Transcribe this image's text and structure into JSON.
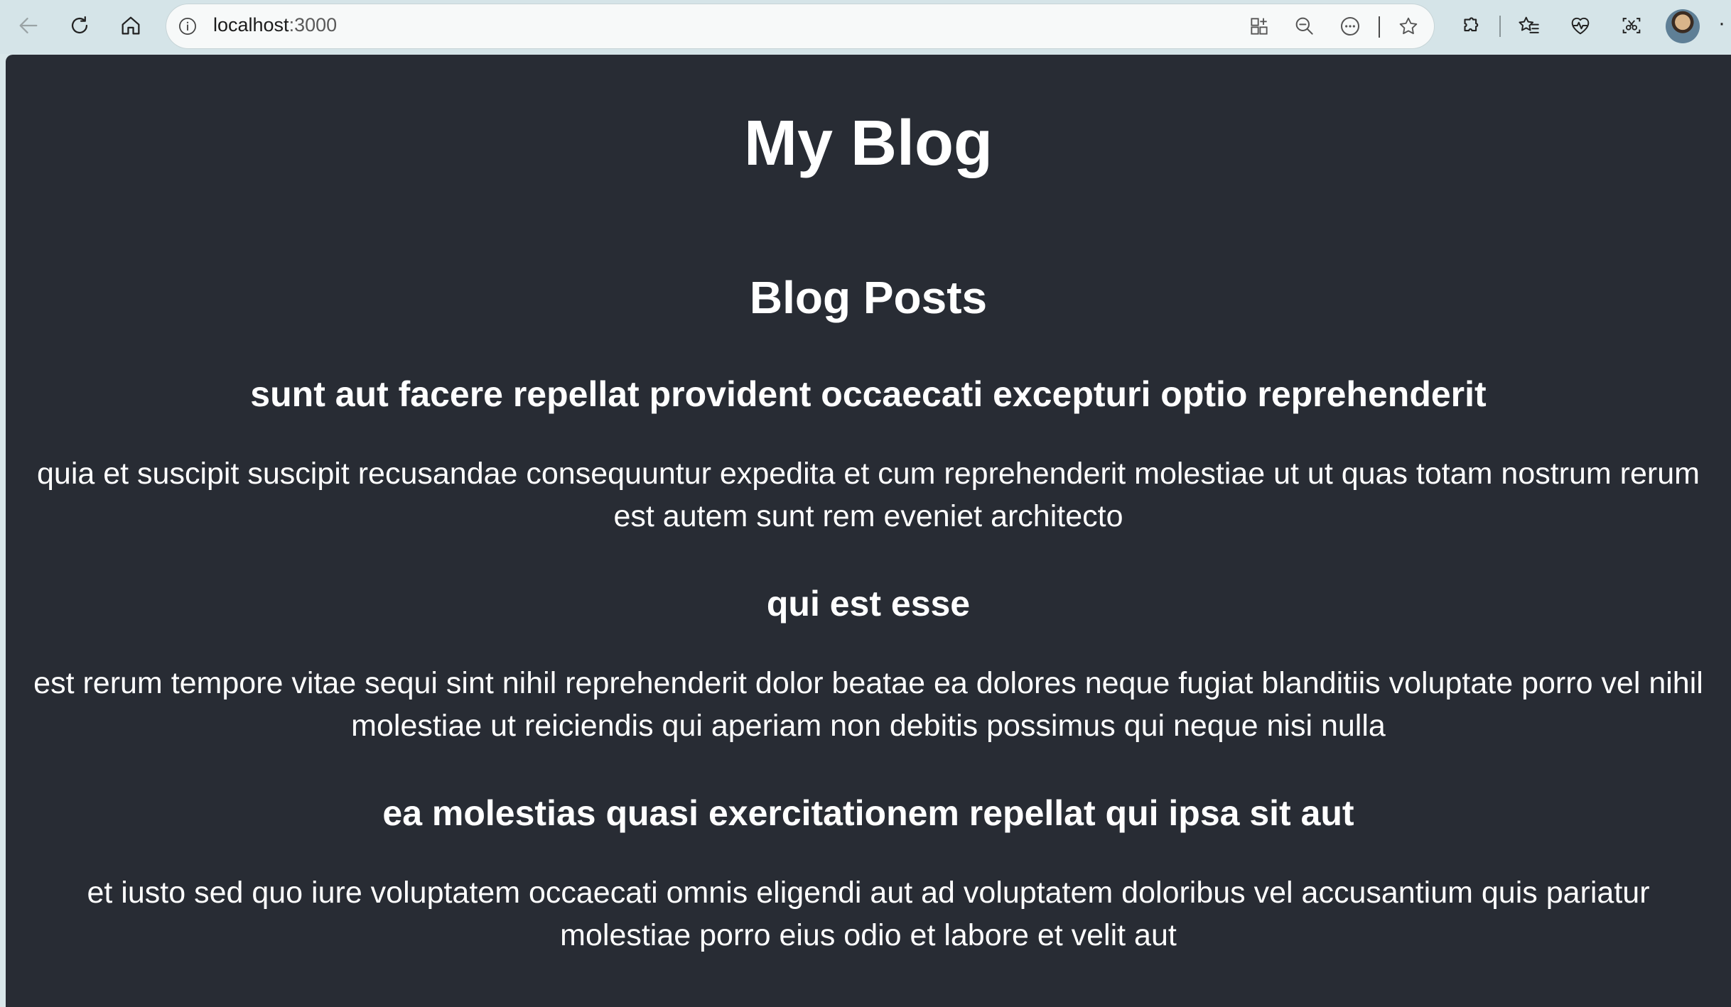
{
  "browser": {
    "url_host": "localhost",
    "url_port": ":3000"
  },
  "page": {
    "site_title": "My Blog",
    "section_title": "Blog Posts",
    "posts": [
      {
        "title": "sunt aut facere repellat provident occaecati excepturi optio reprehenderit",
        "body": "quia et suscipit suscipit recusandae consequuntur expedita et cum reprehenderit molestiae ut ut quas totam nostrum rerum est autem sunt rem eveniet architecto"
      },
      {
        "title": "qui est esse",
        "body": "est rerum tempore vitae sequi sint nihil reprehenderit dolor beatae ea dolores neque fugiat blanditiis voluptate porro vel nihil molestiae ut reiciendis qui aperiam non debitis possimus qui neque nisi nulla"
      },
      {
        "title": "ea molestias quasi exercitationem repellat qui ipsa sit aut",
        "body": "et iusto sed quo iure voluptatem occaecati omnis eligendi aut ad voluptatem doloribus vel accusantium quis pariatur molestiae porro eius odio et labore et velit aut"
      }
    ]
  },
  "colors": {
    "page_background": "#282c34",
    "text": "#ffffff",
    "chrome_background": "#d5e4e8"
  },
  "icons": [
    "back-icon",
    "refresh-icon",
    "home-icon",
    "site-info-icon",
    "app-available-icon",
    "zoom-out-icon",
    "reading-more-icon",
    "favorite-star-icon",
    "extensions-icon",
    "favorites-icon",
    "browser-essentials-icon",
    "screenshot-icon",
    "profile-avatar",
    "more-options-icon"
  ]
}
